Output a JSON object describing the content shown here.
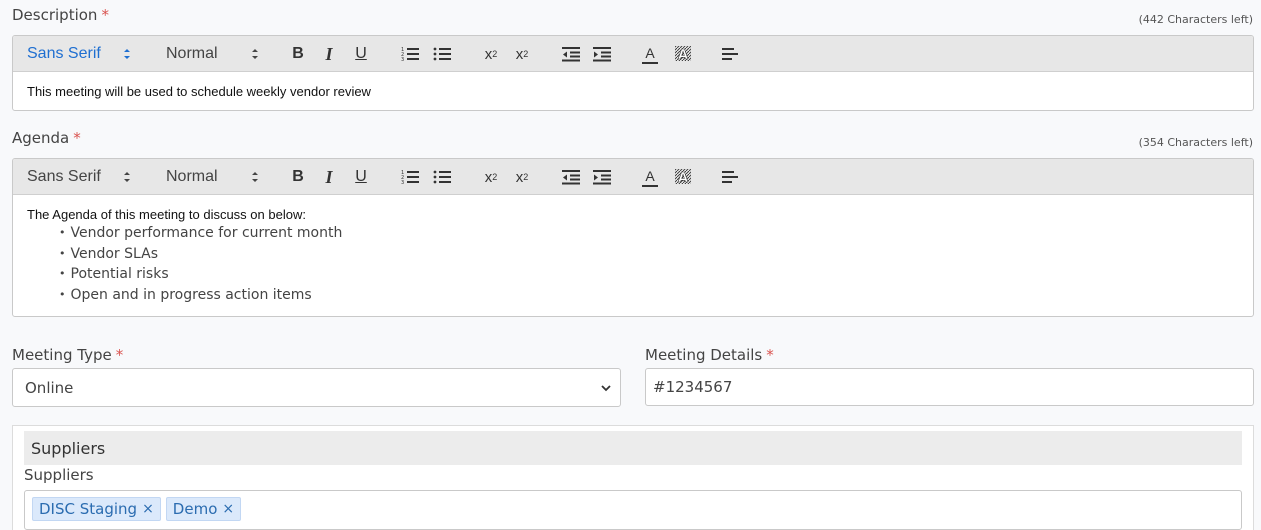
{
  "description": {
    "label": "Description",
    "required_mark": "*",
    "chars_left": "(442 Characters left)",
    "content": "This meeting will be used to schedule weekly vendor review"
  },
  "agenda": {
    "label": "Agenda",
    "required_mark": "*",
    "chars_left": "(354 Characters left)",
    "intro": "The Agenda of this meeting to discuss on below:",
    "items": [
      "Vendor performance for current month",
      "Vendor SLAs",
      "Potential risks",
      "Open and in progress action items"
    ]
  },
  "toolbar": {
    "font_value": "Sans Serif",
    "size_value": "Normal",
    "buttons": [
      "bold-icon",
      "italic-icon",
      "underline-icon",
      "ordered-list-icon",
      "bullet-list-icon",
      "subscript-icon",
      "superscript-icon",
      "outdent-icon",
      "indent-icon",
      "text-color-icon",
      "background-color-icon",
      "align-icon"
    ],
    "bold": "B",
    "italic": "I",
    "underline": "U",
    "subscript": "x",
    "subscript_mark": "2",
    "superscript": "x",
    "superscript_mark": "2",
    "color": "A",
    "background": "A"
  },
  "meeting_type": {
    "label": "Meeting Type",
    "required_mark": "*",
    "value": "Online"
  },
  "meeting_details": {
    "label": "Meeting Details",
    "required_mark": "*",
    "value": "#1234567"
  },
  "suppliers": {
    "section_title": "Suppliers",
    "label": "Suppliers",
    "tags": [
      {
        "name": "DISC Staging",
        "remove": "×"
      },
      {
        "name": "Demo",
        "remove": "×"
      }
    ]
  },
  "colors": {
    "required": "#d9534f",
    "active_picker": "#1f6fd1",
    "tag_bg": "#dbe9fb",
    "tag_text": "#2b6cb0"
  }
}
